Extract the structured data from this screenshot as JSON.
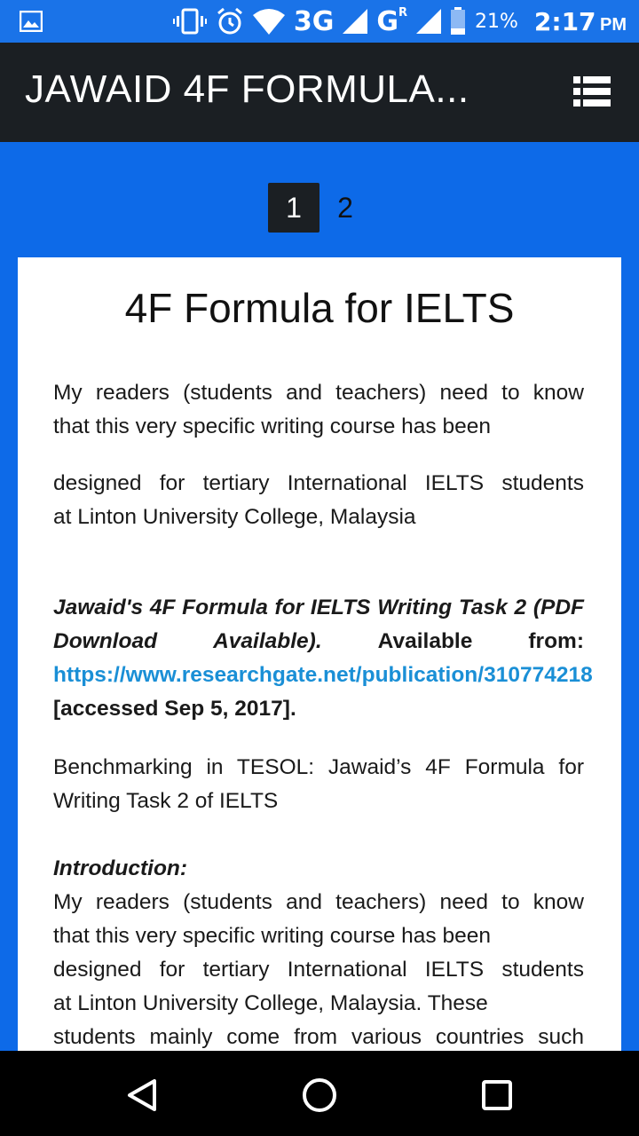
{
  "status_bar": {
    "network_3g": "3G",
    "network_g": "G",
    "roaming": "R",
    "battery": "21%",
    "time": "2:17",
    "ampm": "PM"
  },
  "app_bar": {
    "title": "JAWAID 4F FORMULA...",
    "menu_icon": "list-menu-icon"
  },
  "pagination": {
    "pages": [
      "1",
      "2"
    ],
    "active": "1"
  },
  "article": {
    "title": "4F Formula for IELTS",
    "para1_line1": "My readers (students and teachers) need to know",
    "para1_line2": "that this very specific writing course has been",
    "para2_line1": "designed for tertiary International IELTS students",
    "para2_line2": "at Linton University College, Malaysia",
    "cite_title_1": "Jawaid's 4F Formula for IELTS Writing Task 2 (PDF",
    "cite_title_2a": "Download",
    "cite_title_2b": "Available).",
    "cite_available": "Available",
    "cite_from": "from:",
    "cite_link": "https://www.researchgate.net/publication/310774218",
    "cite_accessed": "[accessed Sep 5, 2017].",
    "para3_line1": "Benchmarking in TESOL: Jawaid’s 4F Formula for",
    "para3_line2": "Writing Task 2 of IELTS",
    "intro_heading": "Introduction:",
    "intro_line1": "My readers (students and teachers) need to know",
    "intro_line2": "that this very specific writing course has been",
    "intro_line3": "designed for tertiary International IELTS students",
    "intro_line4": "at Linton University College, Malaysia. These",
    "intro_line5": "students mainly come from various countries such"
  },
  "colors": {
    "status_bar": "#1a73e8",
    "app_bar": "#1b1f23",
    "background": "#0d6ae8",
    "link": "#1a8fd6"
  }
}
